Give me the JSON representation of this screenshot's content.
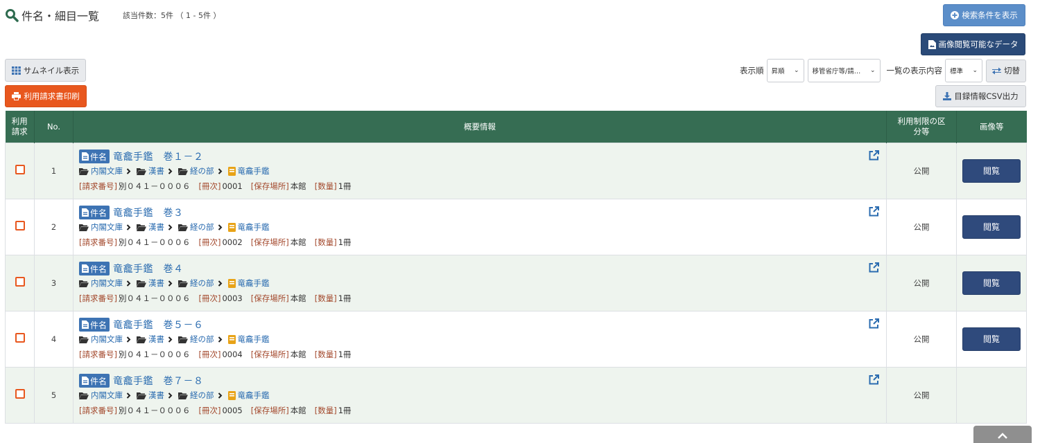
{
  "header": {
    "title": "件名・細目一覧",
    "count": "該当件数：5件 （ 1 - 5件 ）"
  },
  "buttons": {
    "show_search": "検索条件を表示",
    "image_data": "画像閲覧可能なデータ",
    "thumbnail": "サムネイル表示",
    "print_request": "利用請求書印刷",
    "switch": "切替",
    "csv": "目録情報CSV出力"
  },
  "sort": {
    "order_label": "表示順",
    "order_value": "昇順",
    "field_value": "移管省庁等/請…",
    "display_label": "一覧の表示内容",
    "display_value": "標準"
  },
  "table": {
    "headers": {
      "request": "利用請求",
      "no": "No.",
      "summary": "概要情報",
      "restriction": "利用制限の区分等",
      "image": "画像等"
    },
    "badge": "件名",
    "breadcrumb": [
      "内閣文庫",
      "漢書",
      "経の部",
      "竜龕手鑑"
    ],
    "field_labels": {
      "request_no": "[請求番号]",
      "volume": "[冊次]",
      "location": "[保存場所]",
      "quantity": "[数量]"
    },
    "view_label": "閲覧",
    "rows": [
      {
        "no": "1",
        "title": "竜龕手鑑　巻１－２",
        "request_no": "別０４１－０００６",
        "volume": "0001",
        "location": "本館",
        "quantity": "1冊",
        "status": "公開",
        "has_view": true
      },
      {
        "no": "2",
        "title": "竜龕手鑑　巻３",
        "request_no": "別０４１－０００６",
        "volume": "0002",
        "location": "本館",
        "quantity": "1冊",
        "status": "公開",
        "has_view": true
      },
      {
        "no": "3",
        "title": "竜龕手鑑　巻４",
        "request_no": "別０４１－０００６",
        "volume": "0003",
        "location": "本館",
        "quantity": "1冊",
        "status": "公開",
        "has_view": true
      },
      {
        "no": "4",
        "title": "竜龕手鑑　巻５－６",
        "request_no": "別０４１－０００６",
        "volume": "0004",
        "location": "本館",
        "quantity": "1冊",
        "status": "公開",
        "has_view": true
      },
      {
        "no": "5",
        "title": "竜龕手鑑　巻７－８",
        "request_no": "別０４１－０００６",
        "volume": "0005",
        "location": "本館",
        "quantity": "1冊",
        "status": "公開",
        "has_view": false
      }
    ]
  },
  "colors": {
    "header_green": "#366d53",
    "row_tint": "#eef4ee",
    "link_blue": "#2b6cb0",
    "orange": "#e8571e",
    "navy": "#2a4a78"
  }
}
